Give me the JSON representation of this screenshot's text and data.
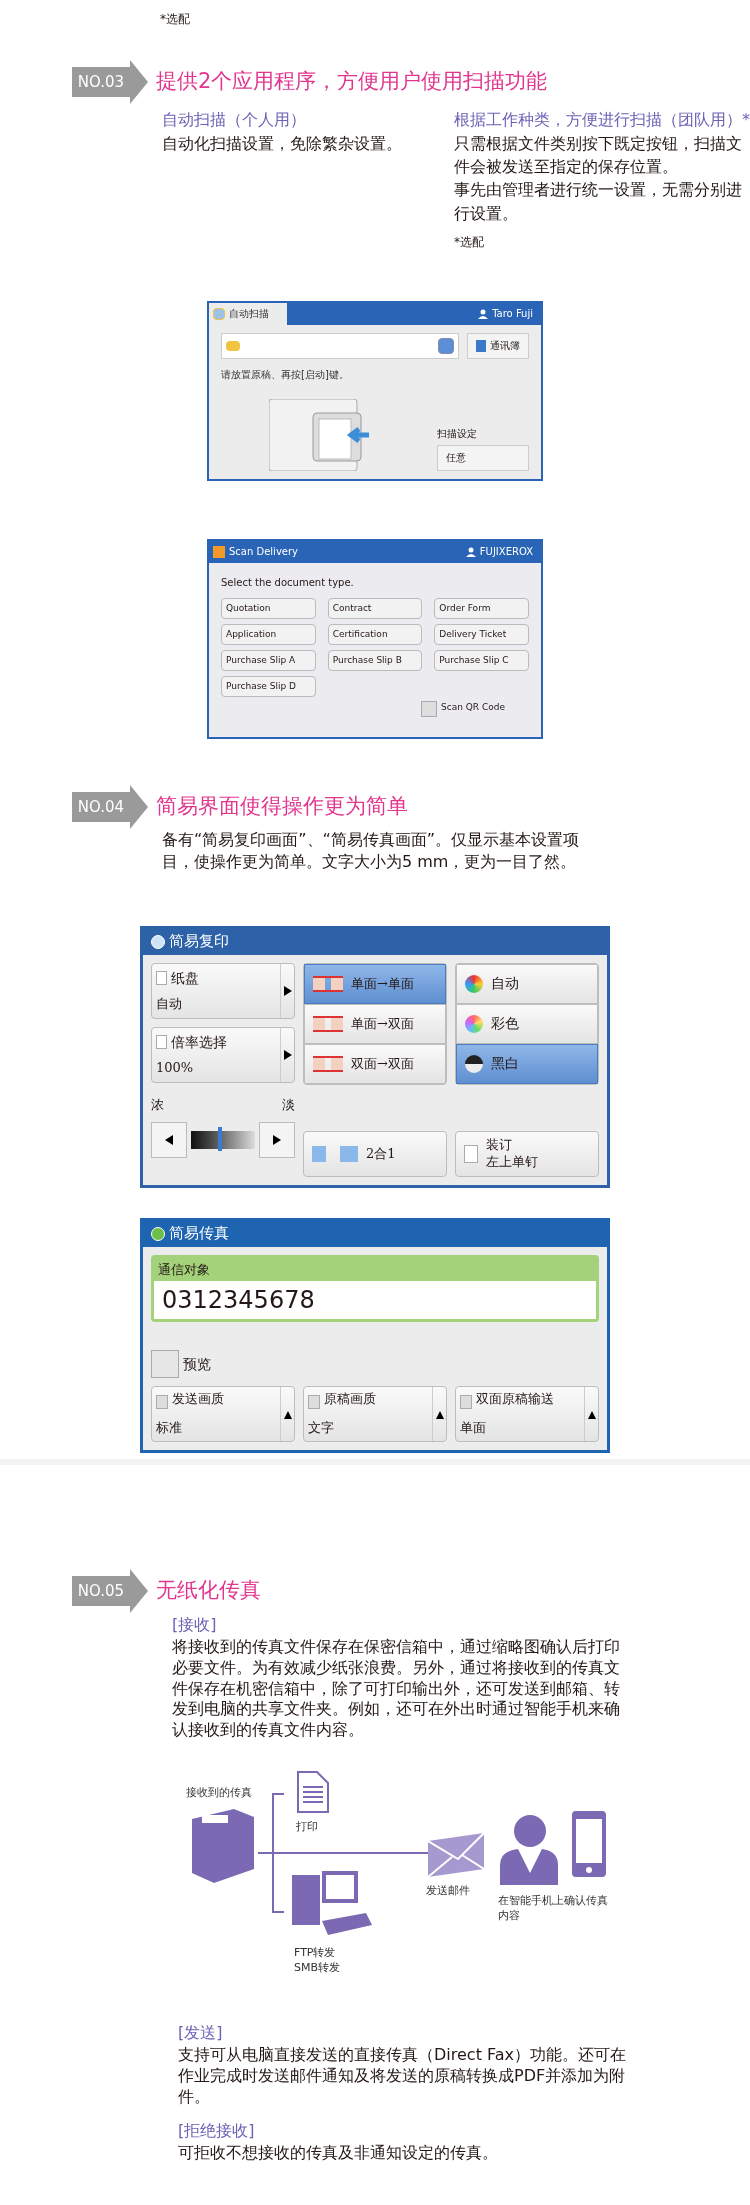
{
  "intro": {
    "footnote": "*选配"
  },
  "section_03": {
    "number": "NO.03",
    "title": "提供2个应用程序，方便用户使用扫描功能",
    "columns": [
      {
        "heading": "自动扫描（个人用）",
        "paragraphs": [
          "自动化扫描设置，免除繁杂设置。"
        ]
      },
      {
        "heading": "根据工作种类，方便进行扫描（团队用）*",
        "paragraphs": [
          "只需根据文件类别按下既定按钮，扫描文件会被发送至指定的保存位置。",
          "事先由管理者进行统一设置，无需分别进行设置。"
        ],
        "footnote": "*选配"
      }
    ]
  },
  "auto_scan_screen": {
    "tab": "自动扫描",
    "user": "Taro Fuji",
    "address_book": "通讯簿",
    "instruction": "请放置原稿、再按[启动]键。",
    "setting_label": "扫描设定",
    "setting_value": "任意"
  },
  "scan_delivery_screen": {
    "title": "Scan Delivery",
    "user": "FUJIXEROX",
    "prompt": "Select the document type.",
    "buttons": [
      "Quotation",
      "Contract",
      "Order Form",
      "Application",
      "Certification",
      "Delivery Ticket",
      "Purchase Slip A",
      "Purchase Slip B",
      "Purchase Slip C",
      "Purchase Slip D"
    ],
    "qr": {
      "label": "Scan QR Code",
      "checked": false
    }
  },
  "section_04": {
    "number": "NO.04",
    "title": "简易界面使得操作更为简单",
    "body": "备有“简易复印画面”、“简易传真画面”。仅显示基本设置项目，使操作更为简单。文字大小为5 mm，更为一目了然。"
  },
  "copy_screen": {
    "title": "简易复印",
    "settings": [
      {
        "label": "纸盘",
        "value": "自动"
      },
      {
        "label": "倍率选择",
        "value": "100%"
      }
    ],
    "density": {
      "dark": "浓",
      "light": "淡",
      "level": 0.45
    },
    "sides": [
      {
        "label": "单面→单面",
        "selected": true
      },
      {
        "label": "单面→双面",
        "selected": false
      },
      {
        "label": "双面→双面",
        "selected": false
      }
    ],
    "color_modes": [
      {
        "label": "自动",
        "selected": false
      },
      {
        "label": "彩色",
        "selected": false
      },
      {
        "label": "黑白",
        "selected": true
      }
    ],
    "nup": "2合1",
    "staple": {
      "label": "装订",
      "value": "左上单钉"
    }
  },
  "fax_screen": {
    "title": "简易传真",
    "recipient_label": "通信对象",
    "recipient_value": "0312345678",
    "preview": {
      "label": "预览",
      "checked": false
    },
    "settings": [
      {
        "label": "发送画质",
        "value": "标准"
      },
      {
        "label": "原稿画质",
        "value": "文字"
      },
      {
        "label": "双面原稿输送",
        "value": "单面"
      }
    ]
  },
  "section_05": {
    "number": "NO.05",
    "title": "无纸化传真",
    "receive": {
      "heading": "[接收]",
      "body": "将接收到的传真文件保存在保密信箱中，通过缩略图确认后打印必要文件。为有效减少纸张浪费。另外，通过将接收到的传真文件保存在机密信箱中，除了可打印输出外，还可发送到邮箱、转发到电脑的共享文件夹。例如，还可在外出时通过智能手机来确认接收到的传真文件内容。"
    },
    "diagram": {
      "fax_label": "接收到的传真",
      "print_label": "打印",
      "pc_labels": [
        "FTP转发",
        "SMB转发"
      ],
      "mail_label": "发送邮件",
      "phone_label": "在智能手机上确认传真内容"
    },
    "send": {
      "heading": "[发送]",
      "body": "支持可从电脑直接发送的直接传真（Direct Fax）功能。还可在作业完成时发送邮件通知及将发送的原稿转换成PDF并添加为附件。"
    },
    "reject": {
      "heading": "[拒绝接收]",
      "body": "可拒收不想接收的传真及非通知设定的传真。"
    }
  }
}
